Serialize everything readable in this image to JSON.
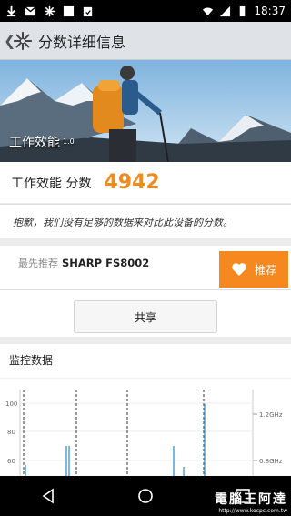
{
  "status_bar": {
    "time": "18:37",
    "left_icons": [
      "download-icon",
      "gmail-icon",
      "snowflake-icon",
      "image-icon",
      "clipboard-icon"
    ],
    "right_icons": [
      "wifi-icon",
      "signal-icon",
      "battery-icon"
    ]
  },
  "app_bar": {
    "title": "分数详细信息"
  },
  "hero": {
    "label": "工作效能",
    "version": "1.0"
  },
  "score": {
    "label": "工作效能 分数",
    "value": "4942",
    "value_color": "#f08c1f"
  },
  "notice": {
    "text": "抱歉，我们没有足够的数据来对比此设备的分数。"
  },
  "recommendation": {
    "prefix": "最先推荐",
    "device": "SHARP FS8002",
    "button_label": "推荐",
    "button_color": "#f5881f"
  },
  "share": {
    "button_label": "共享"
  },
  "monitoring": {
    "title": "监控数据",
    "y_ticks": [
      "100",
      "80",
      "60"
    ],
    "right_ticks": [
      "1.2GHz",
      "0.8GHz"
    ]
  },
  "watermark": {
    "title": "電腦王阿達",
    "url": "http://www.kocpc.com.tw"
  }
}
